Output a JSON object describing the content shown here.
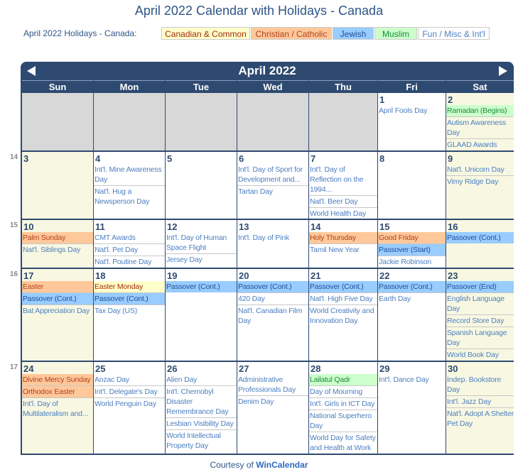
{
  "title": "April 2022 Calendar with Holidays - Canada",
  "legend": {
    "label": "April 2022 Holidays - Canada:",
    "items": [
      {
        "label": "Canadian & Common",
        "bg": "#ffffcc",
        "color": "#a52a0a"
      },
      {
        "label": "Christian / Catholic",
        "bg": "#ffc89a",
        "color": "#b0401a"
      },
      {
        "label": "Jewish",
        "bg": "#99ccff",
        "color": "#1e4f9a"
      },
      {
        "label": "Muslim",
        "bg": "#ccffcc",
        "color": "#1a8a3a"
      },
      {
        "label": "Fun / Misc & Int'l",
        "bg": "#ffffff",
        "color": "#4d7fc0"
      }
    ]
  },
  "calendar": {
    "month_label": "April 2022",
    "prev_icon": "arrow-left-icon",
    "next_icon": "arrow-right-icon",
    "days_of_week": [
      "Sun",
      "Mon",
      "Tue",
      "Wed",
      "Thu",
      "Fri",
      "Sat"
    ],
    "weeks": [
      {
        "week_number": "",
        "days": [
          {
            "day": "",
            "events": []
          },
          {
            "day": "",
            "events": []
          },
          {
            "day": "",
            "events": []
          },
          {
            "day": "",
            "events": []
          },
          {
            "day": "",
            "events": []
          },
          {
            "day": "1",
            "events": [
              {
                "label": "April Fools Day",
                "type": "fun"
              }
            ]
          },
          {
            "day": "2",
            "events": [
              {
                "label": "Ramadan (Begins)",
                "type": "muslim"
              },
              {
                "label": "Autism Awareness Day",
                "type": "fun"
              },
              {
                "label": "GLAAD Awards",
                "type": "fun"
              }
            ]
          }
        ]
      },
      {
        "week_number": "14",
        "days": [
          {
            "day": "3",
            "events": []
          },
          {
            "day": "4",
            "events": [
              {
                "label": "Int'l. Mine Awareness Day",
                "type": "fun"
              },
              {
                "label": "Nat'l. Hug a Newsperson Day",
                "type": "fun"
              }
            ]
          },
          {
            "day": "5",
            "events": []
          },
          {
            "day": "6",
            "events": [
              {
                "label": "Int'l. Day of Sport for Development and...",
                "type": "fun"
              },
              {
                "label": "Tartan Day",
                "type": "fun"
              }
            ]
          },
          {
            "day": "7",
            "events": [
              {
                "label": "Int'l. Day of Reflection on the 1994...",
                "type": "fun"
              },
              {
                "label": "Nat'l. Beer Day",
                "type": "fun"
              },
              {
                "label": "World Health Day",
                "type": "fun"
              }
            ]
          },
          {
            "day": "8",
            "events": []
          },
          {
            "day": "9",
            "events": [
              {
                "label": "Nat'l. Unicorn Day",
                "type": "fun"
              },
              {
                "label": "Vimy Ridge Day",
                "type": "fun"
              }
            ]
          }
        ]
      },
      {
        "week_number": "15",
        "days": [
          {
            "day": "10",
            "events": [
              {
                "label": "Palm Sunday",
                "type": "christian"
              },
              {
                "label": "Nat'l. Siblings Day",
                "type": "fun"
              }
            ]
          },
          {
            "day": "11",
            "events": [
              {
                "label": "CMT Awards",
                "type": "fun"
              },
              {
                "label": "Nat'l. Pet Day",
                "type": "fun"
              },
              {
                "label": "Nat'l. Poutine Day",
                "type": "fun"
              }
            ]
          },
          {
            "day": "12",
            "events": [
              {
                "label": "Int'l. Day of Human Space Flight",
                "type": "fun"
              },
              {
                "label": "Jersey Day",
                "type": "fun"
              }
            ]
          },
          {
            "day": "13",
            "events": [
              {
                "label": "Int'l. Day of Pink",
                "type": "fun"
              }
            ]
          },
          {
            "day": "14",
            "events": [
              {
                "label": "Holy Thursday",
                "type": "christian"
              },
              {
                "label": "Tamil New Year",
                "type": "fun"
              }
            ]
          },
          {
            "day": "15",
            "events": [
              {
                "label": "Good Friday",
                "type": "christian"
              },
              {
                "label": "Passover (Start)",
                "type": "jewish"
              },
              {
                "label": "Jackie Robinson Day",
                "type": "fun"
              }
            ]
          },
          {
            "day": "16",
            "events": [
              {
                "label": "Passover (Cont.)",
                "type": "jewish"
              }
            ]
          }
        ]
      },
      {
        "week_number": "16",
        "days": [
          {
            "day": "17",
            "events": [
              {
                "label": "Easter",
                "type": "christian"
              },
              {
                "label": "Passover (Cont.)",
                "type": "jewish"
              },
              {
                "label": "Bat Appreciation Day",
                "type": "fun"
              }
            ]
          },
          {
            "day": "18",
            "events": [
              {
                "label": "Easter Monday",
                "type": "canadian"
              },
              {
                "label": "Passover (Cont.)",
                "type": "jewish"
              },
              {
                "label": "Tax Day (US)",
                "type": "fun"
              }
            ]
          },
          {
            "day": "19",
            "events": [
              {
                "label": "Passover (Cont.)",
                "type": "jewish"
              }
            ]
          },
          {
            "day": "20",
            "events": [
              {
                "label": "Passover (Cont.)",
                "type": "jewish"
              },
              {
                "label": "420 Day",
                "type": "fun"
              },
              {
                "label": "Nat'l. Canadian Film Day",
                "type": "fun"
              }
            ]
          },
          {
            "day": "21",
            "events": [
              {
                "label": "Passover (Cont.)",
                "type": "jewish"
              },
              {
                "label": "Nat'l. High Five Day",
                "type": "fun"
              },
              {
                "label": "World Creativity and Innovation Day",
                "type": "fun"
              }
            ]
          },
          {
            "day": "22",
            "events": [
              {
                "label": "Passover (Cont.)",
                "type": "jewish"
              },
              {
                "label": "Earth Day",
                "type": "fun"
              }
            ]
          },
          {
            "day": "23",
            "events": [
              {
                "label": "Passover (End)",
                "type": "jewish"
              },
              {
                "label": "English Language Day",
                "type": "fun"
              },
              {
                "label": "Record Store Day",
                "type": "fun"
              },
              {
                "label": "Spanish Language Day",
                "type": "fun"
              },
              {
                "label": "World Book Day",
                "type": "fun"
              }
            ]
          }
        ]
      },
      {
        "week_number": "17",
        "days": [
          {
            "day": "24",
            "events": [
              {
                "label": "Divine Mercy Sunday",
                "type": "christian"
              },
              {
                "label": "Orthodox Easter",
                "type": "christian"
              },
              {
                "label": "Int'l. Day of Multilateralism and...",
                "type": "fun"
              }
            ]
          },
          {
            "day": "25",
            "events": [
              {
                "label": "Anzac Day",
                "type": "fun"
              },
              {
                "label": "Int'l. Delegate's Day",
                "type": "fun"
              },
              {
                "label": "World Penguin Day",
                "type": "fun"
              }
            ]
          },
          {
            "day": "26",
            "events": [
              {
                "label": "Alien Day",
                "type": "fun"
              },
              {
                "label": "Int'l. Chernobyl Disaster Remembrance Day",
                "type": "fun"
              },
              {
                "label": "Lesbian Visibility Day",
                "type": "fun"
              },
              {
                "label": "World Intellectual Property Day",
                "type": "fun"
              }
            ]
          },
          {
            "day": "27",
            "events": [
              {
                "label": "Administrative Professionals Day",
                "type": "fun"
              },
              {
                "label": "Denim Day",
                "type": "fun"
              }
            ]
          },
          {
            "day": "28",
            "events": [
              {
                "label": "Lailatul Qadr",
                "type": "muslim"
              },
              {
                "label": "Day of Mourning",
                "type": "fun"
              },
              {
                "label": "Int'l. Girls in ICT Day",
                "type": "fun"
              },
              {
                "label": "National Superhero Day",
                "type": "fun"
              },
              {
                "label": "World Day for Safety and Health at Work",
                "type": "fun"
              }
            ]
          },
          {
            "day": "29",
            "events": [
              {
                "label": "Int'l. Dance Day",
                "type": "fun"
              }
            ]
          },
          {
            "day": "30",
            "events": [
              {
                "label": "Indep. Bookstore Day",
                "type": "fun"
              },
              {
                "label": "Int'l. Jazz Day",
                "type": "fun"
              },
              {
                "label": "Nat'l. Adopt A Shelter Pet Day",
                "type": "fun"
              }
            ]
          }
        ]
      }
    ]
  },
  "footer": {
    "prefix": "Courtesy of ",
    "link_label": "WinCalendar"
  }
}
